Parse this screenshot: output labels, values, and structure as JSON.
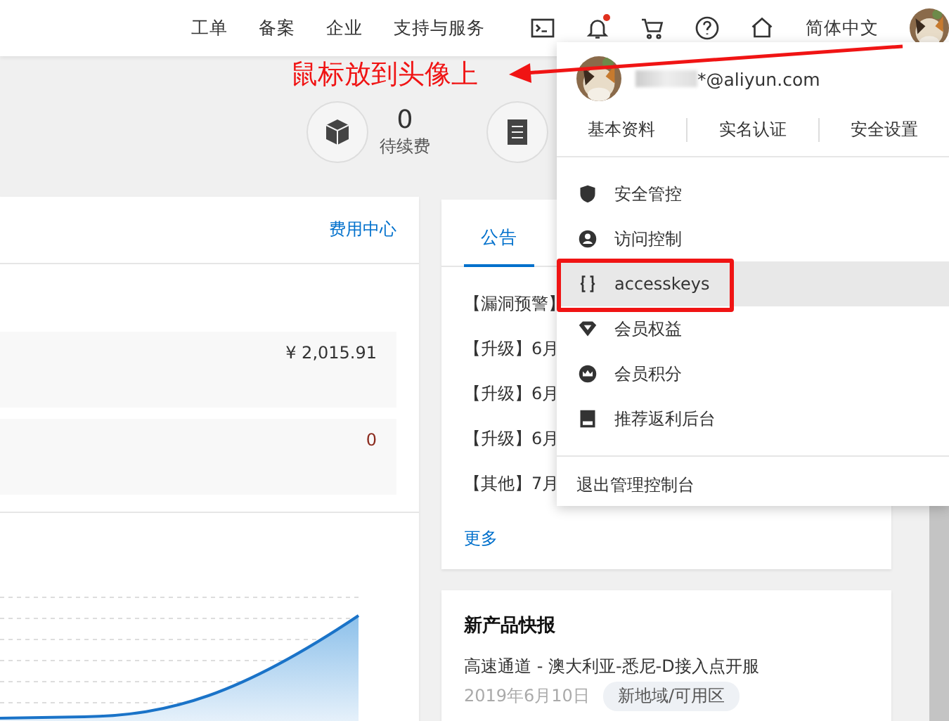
{
  "nav": {
    "links": [
      "工单",
      "备案",
      "企业",
      "支持与服务"
    ],
    "icons": [
      {
        "kind": "terminal"
      },
      {
        "kind": "bell",
        "badge": true
      },
      {
        "kind": "cart"
      },
      {
        "kind": "help"
      },
      {
        "kind": "home"
      }
    ],
    "language": "简体中文"
  },
  "annotation": {
    "text": "鼠标放到头像上"
  },
  "stats": [
    {
      "kind": "box",
      "value": "0",
      "label": "待续费"
    },
    {
      "kind": "doc"
    }
  ],
  "billing": {
    "link": "费用中心",
    "rows": [
      {
        "value": "¥ 2,015.91",
        "color": "#333333"
      },
      {
        "value": "0",
        "color": "#8b2b1e"
      }
    ]
  },
  "notices": {
    "tabs": [
      {
        "label": "公告",
        "selected": true
      }
    ],
    "items": [
      "【漏洞预警】",
      "【升级】6月",
      "【升级】6月",
      "【升级】6月",
      "【其他】7月"
    ],
    "more": "更多"
  },
  "news": {
    "title": "新产品快报",
    "item": "高速通道 - 澳大利亚-悉尼-D接入点开服",
    "date": "2019年6月10日",
    "tag": "新地域/可用区"
  },
  "menu": {
    "email": "*@aliyun.com",
    "links": [
      "基本资料",
      "实名认证",
      "安全设置"
    ],
    "items": [
      {
        "kind": "shield",
        "label": "安全管控",
        "selected": false,
        "highlighted": false
      },
      {
        "kind": "user",
        "label": "访问控制",
        "selected": false,
        "highlighted": false
      },
      {
        "kind": "key",
        "label": "accesskeys",
        "selected": true,
        "highlighted": true
      },
      {
        "kind": "diamond",
        "label": "会员权益",
        "selected": false,
        "highlighted": false
      },
      {
        "kind": "crown",
        "label": "会员积分",
        "selected": false,
        "highlighted": false
      },
      {
        "kind": "card",
        "label": "推荐返利后台",
        "selected": false,
        "highlighted": false
      }
    ],
    "logout": "退出管理控制台"
  }
}
